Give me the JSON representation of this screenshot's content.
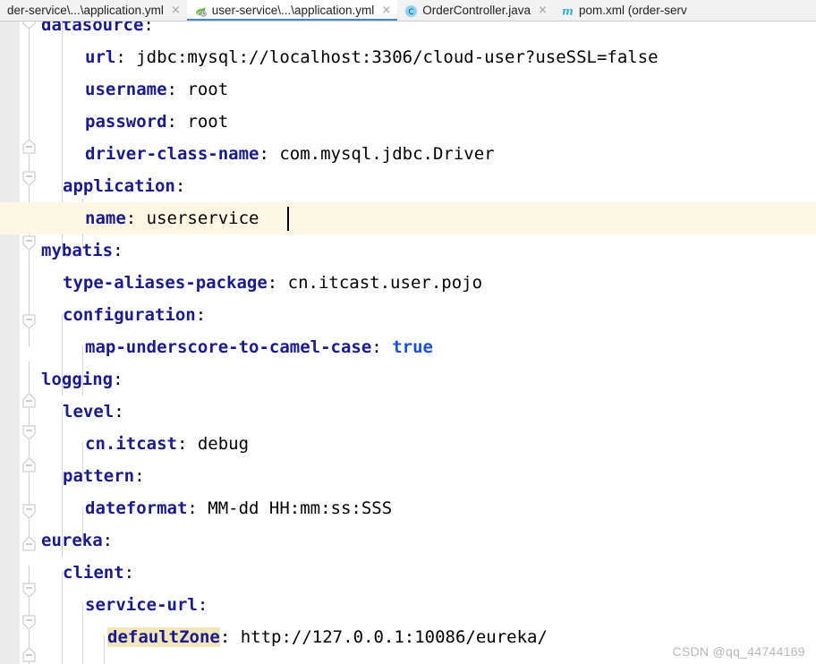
{
  "tabs": [
    {
      "label": "der-service\\...\\application.yml",
      "icon": "",
      "icon_name": "none",
      "active": false,
      "truncated_left": true,
      "closable": true
    },
    {
      "label": "user-service\\...\\application.yml",
      "icon": "spring-leaf-icon",
      "icon_name": "spring-leaf-icon",
      "active": true,
      "closable": true
    },
    {
      "label": "OrderController.java",
      "icon": "java-class-icon",
      "icon_name": "java-class-icon",
      "active": false,
      "closable": true
    },
    {
      "label": "pom.xml (order-serv",
      "icon": "maven-icon",
      "icon_name": "maven-icon",
      "active": false,
      "closable": false
    }
  ],
  "tab_close_glyph": "×",
  "editor": {
    "language": "yaml",
    "file": "application.yml",
    "current_line_index": 5,
    "caret_after_text": "userservice",
    "lines": [
      {
        "indent": 2,
        "text": "datasource:",
        "key": "datasource",
        "value": "",
        "clipped_top": true
      },
      {
        "indent": 4,
        "text": "url: jdbc:mysql://localhost:3306/cloud-user?useSSL=false",
        "key": "url",
        "value": "jdbc:mysql://localhost:3306/cloud-user?useSSL=false"
      },
      {
        "indent": 4,
        "text": "username: root",
        "key": "username",
        "value": "root"
      },
      {
        "indent": 4,
        "text": "password: root",
        "key": "password",
        "value": "root"
      },
      {
        "indent": 4,
        "text": "driver-class-name: com.mysql.jdbc.Driver",
        "key": "driver-class-name",
        "value": "com.mysql.jdbc.Driver"
      },
      {
        "indent": 2,
        "text": "application:",
        "key": "application",
        "value": ""
      },
      {
        "indent": 4,
        "text": "name: userservice",
        "key": "name",
        "value": "userservice",
        "current": true
      },
      {
        "indent": 0,
        "text": "mybatis:",
        "key": "mybatis",
        "value": ""
      },
      {
        "indent": 2,
        "text": "type-aliases-package: cn.itcast.user.pojo",
        "key": "type-aliases-package",
        "value": "cn.itcast.user.pojo"
      },
      {
        "indent": 2,
        "text": "configuration:",
        "key": "configuration",
        "value": ""
      },
      {
        "indent": 4,
        "text": "map-underscore-to-camel-case: true",
        "key": "map-underscore-to-camel-case",
        "value": "true",
        "value_kind": "boolean"
      },
      {
        "indent": 0,
        "text": "logging:",
        "key": "logging",
        "value": ""
      },
      {
        "indent": 2,
        "text": "level:",
        "key": "level",
        "value": ""
      },
      {
        "indent": 4,
        "text": "cn.itcast: debug",
        "key": "cn.itcast",
        "value": "debug"
      },
      {
        "indent": 2,
        "text": "pattern:",
        "key": "pattern",
        "value": ""
      },
      {
        "indent": 4,
        "text": "dateformat: MM-dd HH:mm:ss:SSS",
        "key": "dateformat",
        "value": "MM-dd HH:mm:ss:SSS"
      },
      {
        "indent": 0,
        "text": "eureka:",
        "key": "eureka",
        "value": ""
      },
      {
        "indent": 2,
        "text": "client:",
        "key": "client",
        "value": ""
      },
      {
        "indent": 4,
        "text": "service-url:",
        "key": "service-url",
        "value": ""
      },
      {
        "indent": 6,
        "text": "defaultZone: http://127.0.0.1:10086/eureka/",
        "key": "defaultZone",
        "value": "http://127.0.0.1:10086/eureka/",
        "key_highlighted": true
      }
    ]
  },
  "watermark": "CSDN @qq_44744169",
  "colors": {
    "key": "#1a1a8c",
    "value": "#000000",
    "boolean": "#1a4fd6",
    "current_line_bg": "#fdf8e3",
    "search_highlight_bg": "#f2e6bd",
    "gutter_bg": "#ebebeb",
    "tabbar_bg": "#f2f2f2",
    "active_tab_underline": "#4a86c5",
    "editor_bg": "#ffffff",
    "watermark": "#b7b7b7"
  }
}
